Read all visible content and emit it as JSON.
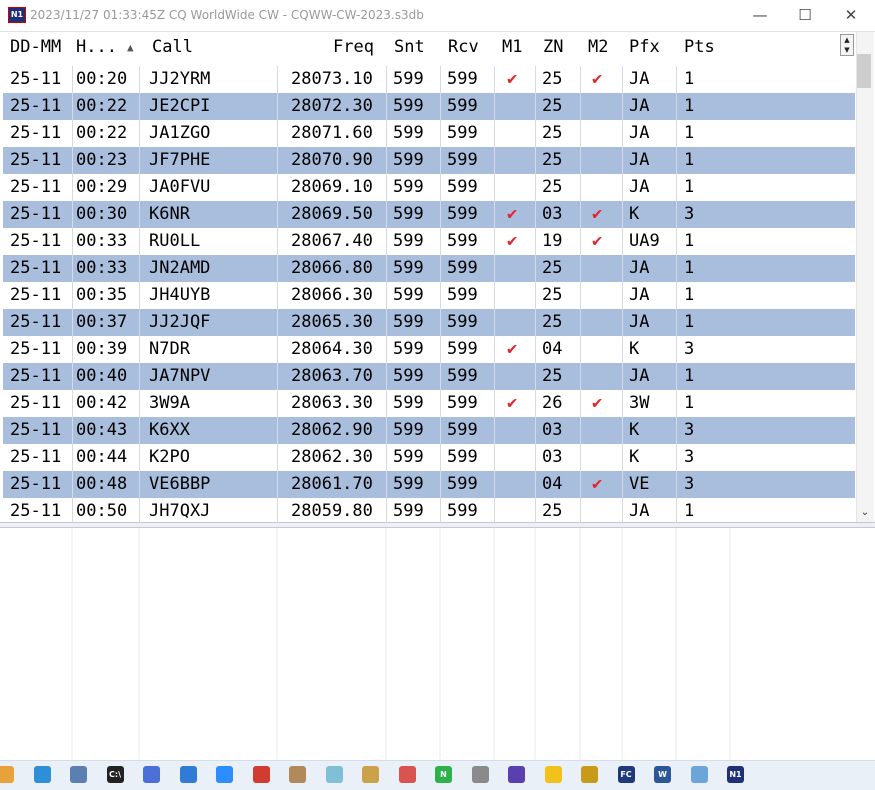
{
  "window": {
    "title": "2023/11/27 01:33:45Z  CQ WorldWide CW - CQWW-CW-2023.s3db",
    "icon": "n1mm-logo-icon",
    "minimize_glyph": "—",
    "maximize_glyph": "☐",
    "close_glyph": "✕"
  },
  "table": {
    "columns": [
      "DD-MM",
      "H...",
      "Call",
      "Freq",
      "Snt",
      "Rcv",
      "M1",
      "ZN",
      "M2",
      "Pfx",
      "Pts"
    ],
    "sort_glyph": "▲",
    "tick_glyph": "✔",
    "rows": [
      {
        "date": "25-11",
        "time": "00:20",
        "call": "JJ2YRM",
        "freq": "28073.10",
        "snt": "599",
        "rcv": "599",
        "m1": "✔",
        "zn": "25",
        "m2": "✔",
        "pfx": "JA",
        "pts": "1"
      },
      {
        "date": "25-11",
        "time": "00:22",
        "call": "JE2CPI",
        "freq": "28072.30",
        "snt": "599",
        "rcv": "599",
        "m1": "",
        "zn": "25",
        "m2": "",
        "pfx": "JA",
        "pts": "1"
      },
      {
        "date": "25-11",
        "time": "00:22",
        "call": "JA1ZGO",
        "freq": "28071.60",
        "snt": "599",
        "rcv": "599",
        "m1": "",
        "zn": "25",
        "m2": "",
        "pfx": "JA",
        "pts": "1"
      },
      {
        "date": "25-11",
        "time": "00:23",
        "call": "JF7PHE",
        "freq": "28070.90",
        "snt": "599",
        "rcv": "599",
        "m1": "",
        "zn": "25",
        "m2": "",
        "pfx": "JA",
        "pts": "1"
      },
      {
        "date": "25-11",
        "time": "00:29",
        "call": "JA0FVU",
        "freq": "28069.10",
        "snt": "599",
        "rcv": "599",
        "m1": "",
        "zn": "25",
        "m2": "",
        "pfx": "JA",
        "pts": "1"
      },
      {
        "date": "25-11",
        "time": "00:30",
        "call": "K6NR",
        "freq": "28069.50",
        "snt": "599",
        "rcv": "599",
        "m1": "✔",
        "zn": "03",
        "m2": "✔",
        "pfx": "K",
        "pts": "3"
      },
      {
        "date": "25-11",
        "time": "00:33",
        "call": "RU0LL",
        "freq": "28067.40",
        "snt": "599",
        "rcv": "599",
        "m1": "✔",
        "zn": "19",
        "m2": "✔",
        "pfx": "UA9",
        "pts": "1"
      },
      {
        "date": "25-11",
        "time": "00:33",
        "call": "JN2AMD",
        "freq": "28066.80",
        "snt": "599",
        "rcv": "599",
        "m1": "",
        "zn": "25",
        "m2": "",
        "pfx": "JA",
        "pts": "1"
      },
      {
        "date": "25-11",
        "time": "00:35",
        "call": "JH4UYB",
        "freq": "28066.30",
        "snt": "599",
        "rcv": "599",
        "m1": "",
        "zn": "25",
        "m2": "",
        "pfx": "JA",
        "pts": "1"
      },
      {
        "date": "25-11",
        "time": "00:37",
        "call": "JJ2JQF",
        "freq": "28065.30",
        "snt": "599",
        "rcv": "599",
        "m1": "",
        "zn": "25",
        "m2": "",
        "pfx": "JA",
        "pts": "1"
      },
      {
        "date": "25-11",
        "time": "00:39",
        "call": "N7DR",
        "freq": "28064.30",
        "snt": "599",
        "rcv": "599",
        "m1": "✔",
        "zn": "04",
        "m2": "",
        "pfx": "K",
        "pts": "3"
      },
      {
        "date": "25-11",
        "time": "00:40",
        "call": "JA7NPV",
        "freq": "28063.70",
        "snt": "599",
        "rcv": "599",
        "m1": "",
        "zn": "25",
        "m2": "",
        "pfx": "JA",
        "pts": "1"
      },
      {
        "date": "25-11",
        "time": "00:42",
        "call": "3W9A",
        "freq": "28063.30",
        "snt": "599",
        "rcv": "599",
        "m1": "✔",
        "zn": "26",
        "m2": "✔",
        "pfx": "3W",
        "pts": "1"
      },
      {
        "date": "25-11",
        "time": "00:43",
        "call": "K6XX",
        "freq": "28062.90",
        "snt": "599",
        "rcv": "599",
        "m1": "",
        "zn": "03",
        "m2": "",
        "pfx": "K",
        "pts": "3"
      },
      {
        "date": "25-11",
        "time": "00:44",
        "call": "K2PO",
        "freq": "28062.30",
        "snt": "599",
        "rcv": "599",
        "m1": "",
        "zn": "03",
        "m2": "",
        "pfx": "K",
        "pts": "3"
      },
      {
        "date": "25-11",
        "time": "00:48",
        "call": "VE6BBP",
        "freq": "28061.70",
        "snt": "599",
        "rcv": "599",
        "m1": "",
        "zn": "04",
        "m2": "✔",
        "pfx": "VE",
        "pts": "3"
      },
      {
        "date": "25-11",
        "time": "00:50",
        "call": "JH7QXJ",
        "freq": "28059.80",
        "snt": "599",
        "rcv": "599",
        "m1": "",
        "zn": "25",
        "m2": "",
        "pfx": "JA",
        "pts": "1"
      }
    ]
  },
  "colors": {
    "alt_row": "#a9bedd",
    "tick": "#e0262b"
  },
  "taskbar": {
    "icons": [
      {
        "name": "folder-icon",
        "color": "#e8a23a",
        "glyph": ""
      },
      {
        "name": "monitor-icon",
        "color": "#2e8fd6",
        "glyph": ""
      },
      {
        "name": "network-icon",
        "color": "#5a7fb0",
        "glyph": ""
      },
      {
        "name": "terminal-icon",
        "color": "#222222",
        "glyph": "C:\\"
      },
      {
        "name": "browser-icon",
        "color": "#4d6fd8",
        "glyph": ""
      },
      {
        "name": "photos-icon",
        "color": "#2f7bd5",
        "glyph": ""
      },
      {
        "name": "zoom-icon",
        "color": "#2d8cff",
        "glyph": ""
      },
      {
        "name": "pdf-icon",
        "color": "#d23b2f",
        "glyph": ""
      },
      {
        "name": "map-icon",
        "color": "#b08a5a",
        "glyph": ""
      },
      {
        "name": "notes-icon",
        "color": "#7fc0d8",
        "glyph": ""
      },
      {
        "name": "editor-icon",
        "color": "#c9a24a",
        "glyph": ""
      },
      {
        "name": "tool-icon",
        "color": "#d9534f",
        "glyph": ""
      },
      {
        "name": "n-app-icon",
        "color": "#2bb34a",
        "glyph": "N"
      },
      {
        "name": "alien-icon",
        "color": "#8a8a8a",
        "glyph": ""
      },
      {
        "name": "media-icon",
        "color": "#5a3fb0",
        "glyph": ""
      },
      {
        "name": "video-icon",
        "color": "#f2c21b",
        "glyph": ""
      },
      {
        "name": "ball-icon",
        "color": "#c79a1a",
        "glyph": ""
      },
      {
        "name": "fc-icon",
        "color": "#1f3a7a",
        "glyph": "FC"
      },
      {
        "name": "word-icon",
        "color": "#2b579a",
        "glyph": "W"
      },
      {
        "name": "link-icon",
        "color": "#6aa6d8",
        "glyph": ""
      },
      {
        "name": "n1mm-icon",
        "color": "#1f2f7a",
        "glyph": "N1"
      }
    ]
  }
}
